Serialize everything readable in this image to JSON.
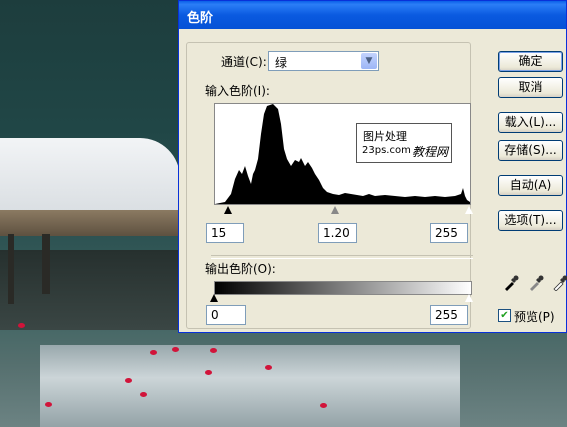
{
  "dialog": {
    "title": "色阶"
  },
  "channel": {
    "label": "通道(C):",
    "value": "绿"
  },
  "input_levels": {
    "label": "输入色阶(I):",
    "black": "15",
    "gamma": "1.20",
    "white": "255"
  },
  "watermark": {
    "line1": "图片处理",
    "line2": "23ps.com",
    "line3": "教程网"
  },
  "output_levels": {
    "label": "输出色阶(O):",
    "black": "0",
    "white": "255"
  },
  "buttons": {
    "ok": "确定",
    "cancel": "取消",
    "load": "载入(L)...",
    "save": "存储(S)...",
    "auto": "自动(A)",
    "options": "选项(T)..."
  },
  "preview": {
    "label": "预览(P)",
    "checked": true
  },
  "icons": [
    "black-eyedropper-icon",
    "gray-eyedropper-icon",
    "white-eyedropper-icon",
    "dropdown-arrow-icon"
  ],
  "colors": {
    "titlebar": "#0a5ae0",
    "dialog_bg": "#ece9d8"
  }
}
